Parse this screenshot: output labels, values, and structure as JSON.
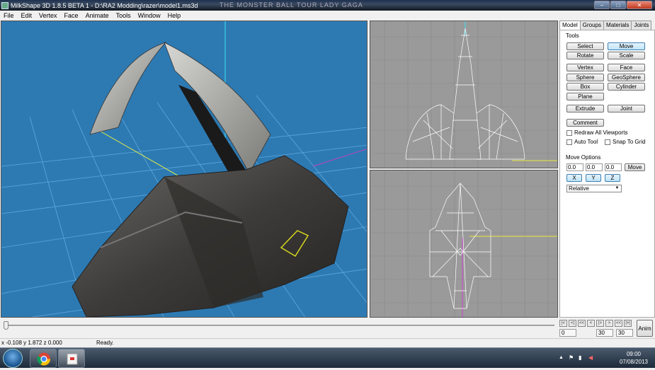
{
  "window": {
    "title": "MilkShape 3D 1.8.5 BETA 1 - D:\\RA2 Modding\\razer\\model1.ms3d",
    "background_text": "THE MONSTER BALL TOUR  LADY GAGA",
    "min_label": "–",
    "max_label": "□",
    "close_label": "✕"
  },
  "menu": [
    "File",
    "Edit",
    "Vertex",
    "Face",
    "Animate",
    "Tools",
    "Window",
    "Help"
  ],
  "panel": {
    "tabs": [
      "Model",
      "Groups",
      "Materials",
      "Joints"
    ],
    "tools_heading": "Tools",
    "tools": {
      "select": "Select",
      "move": "Move",
      "rotate": "Rotate",
      "scale": "Scale",
      "vertex": "Vertex",
      "face": "Face",
      "sphere": "Sphere",
      "geosphere": "GeoSphere",
      "box": "Box",
      "cylinder": "Cylinder",
      "plane": "Plane",
      "extrude": "Extrude",
      "joint": "Joint",
      "comment": "Comment"
    },
    "checks": {
      "redraw": "Redraw All Viewports",
      "auto_tool": "Auto Tool",
      "snap": "Snap To Grid"
    },
    "move_options": {
      "heading": "Move Options",
      "x": "0.0",
      "y": "0.0",
      "z": "0.0",
      "move_btn": "Move",
      "axis_x": "X",
      "axis_y": "Y",
      "axis_z": "Z",
      "mode": "Relative"
    }
  },
  "anim": {
    "nav": [
      "|<",
      "<|",
      "<<",
      "<",
      "|>",
      ">",
      "<<",
      "|>|"
    ],
    "frame_current": "0",
    "frame_start": "30",
    "frame_end": "30",
    "anim_btn": "Anim"
  },
  "status": {
    "coords": "x -0.108 y 1.872 z 0.000",
    "message": "Ready."
  },
  "taskbar": {
    "time": "09:00",
    "date": "07/08/2013"
  },
  "colors": {
    "viewport_3d": "#2d7ab3",
    "viewport_2d": "#9a9a9a",
    "wire": "#ffffff"
  }
}
